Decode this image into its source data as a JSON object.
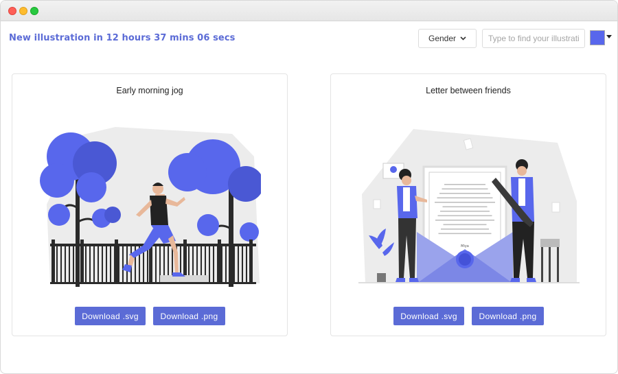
{
  "window": {
    "traffic_lights": [
      "close",
      "minimize",
      "zoom"
    ]
  },
  "header": {
    "countdown": "New illustration in 12 hours 37 mins 06 secs",
    "gender_label": "Gender",
    "search_placeholder": "Type to find your illustration",
    "search_value": "",
    "accent_color": "#5b6bd6",
    "swatch_color": "#5867ec"
  },
  "cards": [
    {
      "title": "Early morning jog",
      "download_svg": "Download .svg",
      "download_png": "Download .png"
    },
    {
      "title": "Letter between friends",
      "download_svg": "Download .svg",
      "download_png": "Download .png",
      "signature": "Miya"
    }
  ],
  "icons": {
    "gender_caret": "chevron-down-icon",
    "color_caret": "caret-down-icon"
  }
}
